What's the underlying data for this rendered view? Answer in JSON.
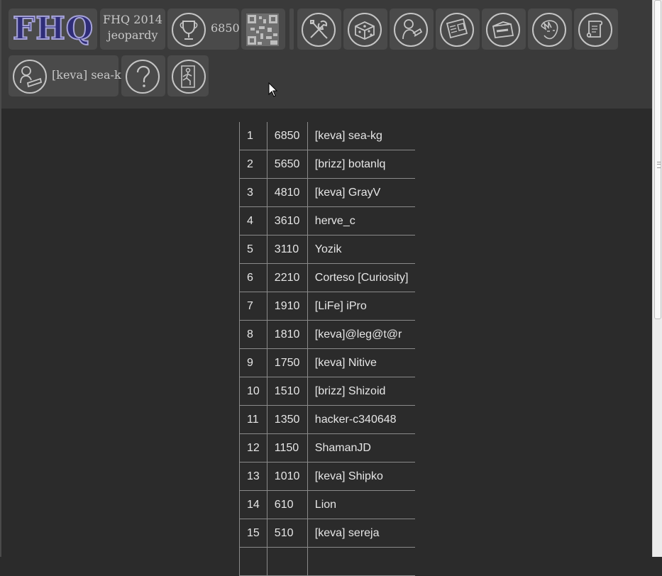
{
  "toolbar": {
    "logo": "FHQ",
    "game_title_line1": "FHQ 2014",
    "game_title_line2": "jeopardy",
    "score": "6850",
    "user_name": "[keva] sea-kg",
    "icons": [
      "trophy-icon",
      "qr-code-icon",
      "tools-icon",
      "dice-icon",
      "hacker-icon",
      "news-icon",
      "feedback-box-icon",
      "avatar-face-icon",
      "rules-scroll-icon",
      "user-profile-icon",
      "help-icon",
      "exit-icon"
    ]
  },
  "scoreboard": {
    "rows": [
      {
        "rank": "1",
        "score": "6850",
        "name": "[keva] sea-kg"
      },
      {
        "rank": "2",
        "score": "5650",
        "name": "[brizz] botanlq"
      },
      {
        "rank": "3",
        "score": "4810",
        "name": "[keva] GrayV"
      },
      {
        "rank": "4",
        "score": "3610",
        "name": "herve_c"
      },
      {
        "rank": "5",
        "score": "3110",
        "name": "Yozik"
      },
      {
        "rank": "6",
        "score": "2210",
        "name": "Corteso [Curiosity]"
      },
      {
        "rank": "7",
        "score": "1910",
        "name": "[LiFe] iPro"
      },
      {
        "rank": "8",
        "score": "1810",
        "name": "[keva]@leg@t@r"
      },
      {
        "rank": "9",
        "score": "1750",
        "name": "[keva] Nitive"
      },
      {
        "rank": "10",
        "score": "1510",
        "name": "[brizz] Shizoid"
      },
      {
        "rank": "11",
        "score": "1350",
        "name": "hacker-c340648"
      },
      {
        "rank": "12",
        "score": "1150",
        "name": "ShamanJD"
      },
      {
        "rank": "13",
        "score": "1010",
        "name": "[keva] Shipko"
      },
      {
        "rank": "14",
        "score": "610",
        "name": "Lion"
      },
      {
        "rank": "15",
        "score": "510",
        "name": "[keva] sereja"
      },
      {
        "rank": "",
        "score": "",
        "name": ""
      }
    ]
  },
  "colors": {
    "page_bg": "#2b2b2b",
    "toolbar_bg": "#3a3a3a",
    "button_bg": "#4a4a4a",
    "icon_stroke": "#c4c4c4",
    "logo_fill": "#2f2d78",
    "text": "#e6e6e6"
  }
}
